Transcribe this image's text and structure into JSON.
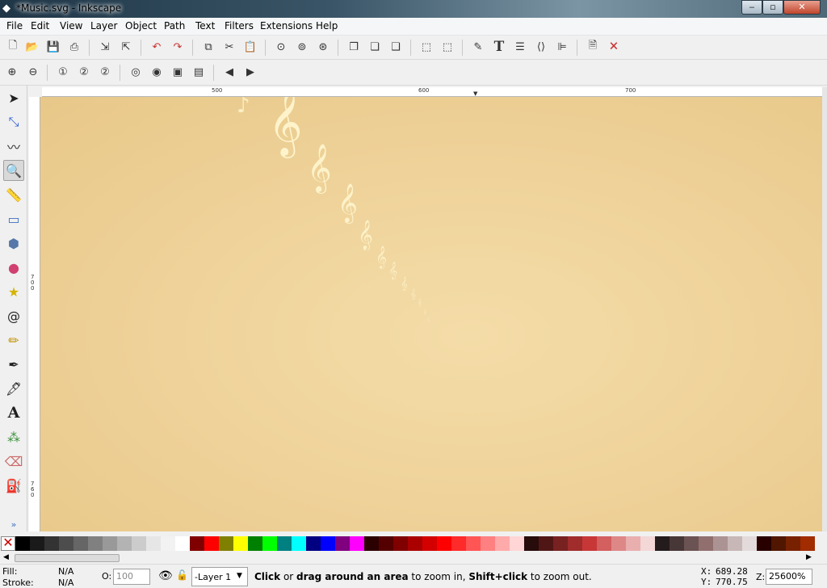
{
  "window": {
    "title": "*Music.svg - Inkscape",
    "minimize": "‒",
    "maximize": "▫",
    "close": "✕"
  },
  "menu": [
    "File",
    "Edit",
    "View",
    "Layer",
    "Object",
    "Path",
    "Text",
    "Filters",
    "Extensions",
    "Help"
  ],
  "ruler": {
    "h_labels": [
      "500",
      "600",
      "700"
    ],
    "v_labels": [
      "700",
      "760"
    ]
  },
  "colors": {
    "canvas_light": "#f4dca8",
    "canvas_dark": "#e8c889",
    "clef": "#fff6cf"
  },
  "palette": [
    "#000000",
    "#1a1a1a",
    "#333333",
    "#4d4d4d",
    "#666666",
    "#808080",
    "#999999",
    "#b3b3b3",
    "#cccccc",
    "#e6e6e6",
    "#f2f2f2",
    "#ffffff",
    "#800000",
    "#ff0000",
    "#808000",
    "#ffff00",
    "#008000",
    "#00ff00",
    "#008080",
    "#00ffff",
    "#000080",
    "#0000ff",
    "#800080",
    "#ff00ff",
    "#2b0000",
    "#550000",
    "#800000",
    "#aa0000",
    "#d40000",
    "#ff0000",
    "#ff2a2a",
    "#ff5555",
    "#ff8080",
    "#ffaaaa",
    "#ffd5d5",
    "#280b0b",
    "#501616",
    "#782121",
    "#a02c2c",
    "#c83737",
    "#d35f5f",
    "#de8787",
    "#e9afaf",
    "#f4d7d7",
    "#241c1c",
    "#483737",
    "#6c5353",
    "#916f6f",
    "#ac9393",
    "#c8b7b7",
    "#e3dbdb",
    "#280000",
    "#501600",
    "#782100",
    "#a02c00",
    "#c83700"
  ],
  "status": {
    "fill_label": "Fill:",
    "fill_value": "N/A",
    "stroke_label": "Stroke:",
    "stroke_value": "N/A",
    "opacity_label": "O:",
    "opacity_value": "100",
    "layer_value": "-Layer 1",
    "message_click": "Click",
    "message_mid": " or ",
    "message_drag": "drag around an area",
    "message_to": " to zoom in, ",
    "message_shift": "Shift+click",
    "message_end": " to zoom out.",
    "x_label": "X:",
    "x_value": "689.28",
    "y_label": "Y:",
    "y_value": "770.75",
    "z_label": "Z:",
    "zoom_value": "25600%"
  }
}
